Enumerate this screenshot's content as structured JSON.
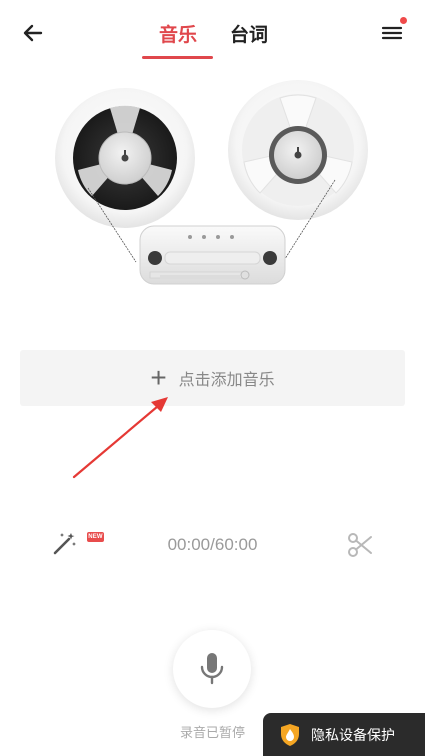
{
  "header": {
    "tab_music": "音乐",
    "tab_lyrics": "台词"
  },
  "add_music": {
    "label": "点击添加音乐"
  },
  "toolbar": {
    "new_badge": "NEW",
    "time": "00:00/60:00"
  },
  "record": {
    "status": "录音已暂停"
  },
  "privacy": {
    "label": "隐私设备保护"
  },
  "colors": {
    "accent": "#e0474c",
    "badge": "#f04a4a"
  },
  "icons": [
    "back-arrow-icon",
    "menu-icon",
    "magic-wand-icon",
    "scissors-icon",
    "microphone-icon",
    "shield-icon"
  ]
}
